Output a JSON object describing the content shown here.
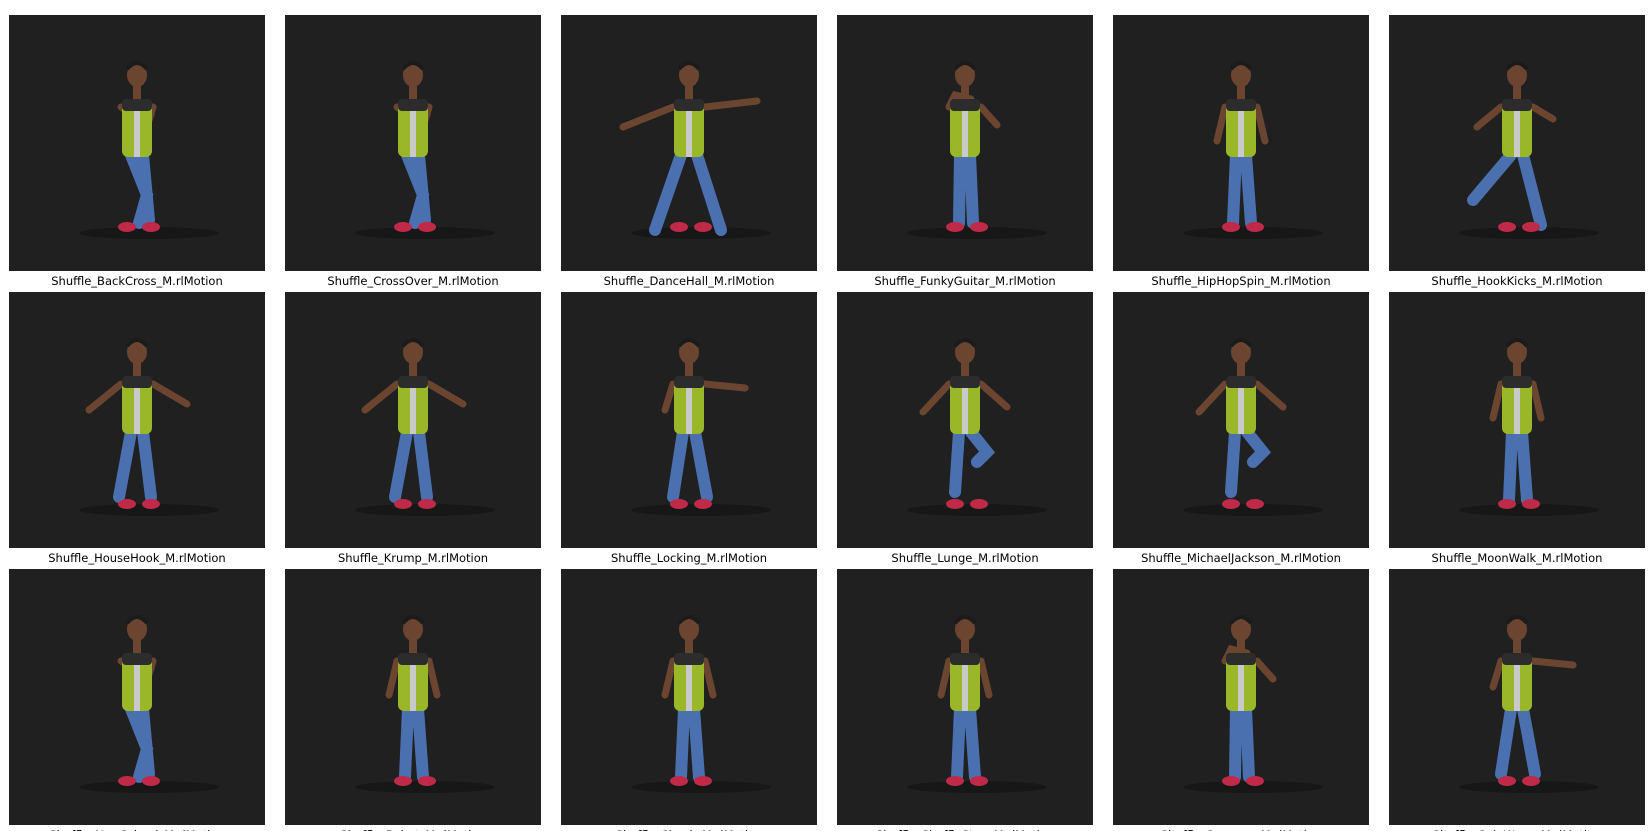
{
  "files": [
    {
      "name": "Shuffle_BackCross_M.rlMotion",
      "pose": "crossed"
    },
    {
      "name": "Shuffle_CrossOver_M.rlMotion",
      "pose": "crossed"
    },
    {
      "name": "Shuffle_DanceHall_M.rlMotion",
      "pose": "wide"
    },
    {
      "name": "Shuffle_FunkyGuitar_M.rlMotion",
      "pose": "guitar"
    },
    {
      "name": "Shuffle_HipHopSpin_M.rlMotion",
      "pose": "stand"
    },
    {
      "name": "Shuffle_HookKicks_M.rlMotion",
      "pose": "kick"
    },
    {
      "name": "Shuffle_HouseHook_M.rlMotion",
      "pose": "armsout"
    },
    {
      "name": "Shuffle_Krump_M.rlMotion",
      "pose": "armsout"
    },
    {
      "name": "Shuffle_Locking_M.rlMotion",
      "pose": "point"
    },
    {
      "name": "Shuffle_Lunge_M.rlMotion",
      "pose": "kneeup"
    },
    {
      "name": "Shuffle_MichaelJackson_M.rlMotion",
      "pose": "kneeup"
    },
    {
      "name": "Shuffle_MoonWalk_M.rlMotion",
      "pose": "stand"
    },
    {
      "name": "Shuffle_NewSchool_M.rlMotion",
      "pose": "crossed"
    },
    {
      "name": "Shuffle_Robot_M.rlMotion",
      "pose": "stand"
    },
    {
      "name": "Shuffle_Shuck_M.rlMotion",
      "pose": "stand"
    },
    {
      "name": "Shuffle_ShuffleStep_M.rlMotion",
      "pose": "stand"
    },
    {
      "name": "Shuffle_Sorcerer_M.rlMotion",
      "pose": "guitar"
    },
    {
      "name": "Shuffle_SpinWave_M.rlMotion",
      "pose": "point"
    }
  ],
  "colors": {
    "thumbnail_bg": "#202020",
    "vest": "#9ab72a",
    "jeans": "#4a70b0",
    "sneakers": "#c02a48",
    "skin": "#6b4530"
  }
}
